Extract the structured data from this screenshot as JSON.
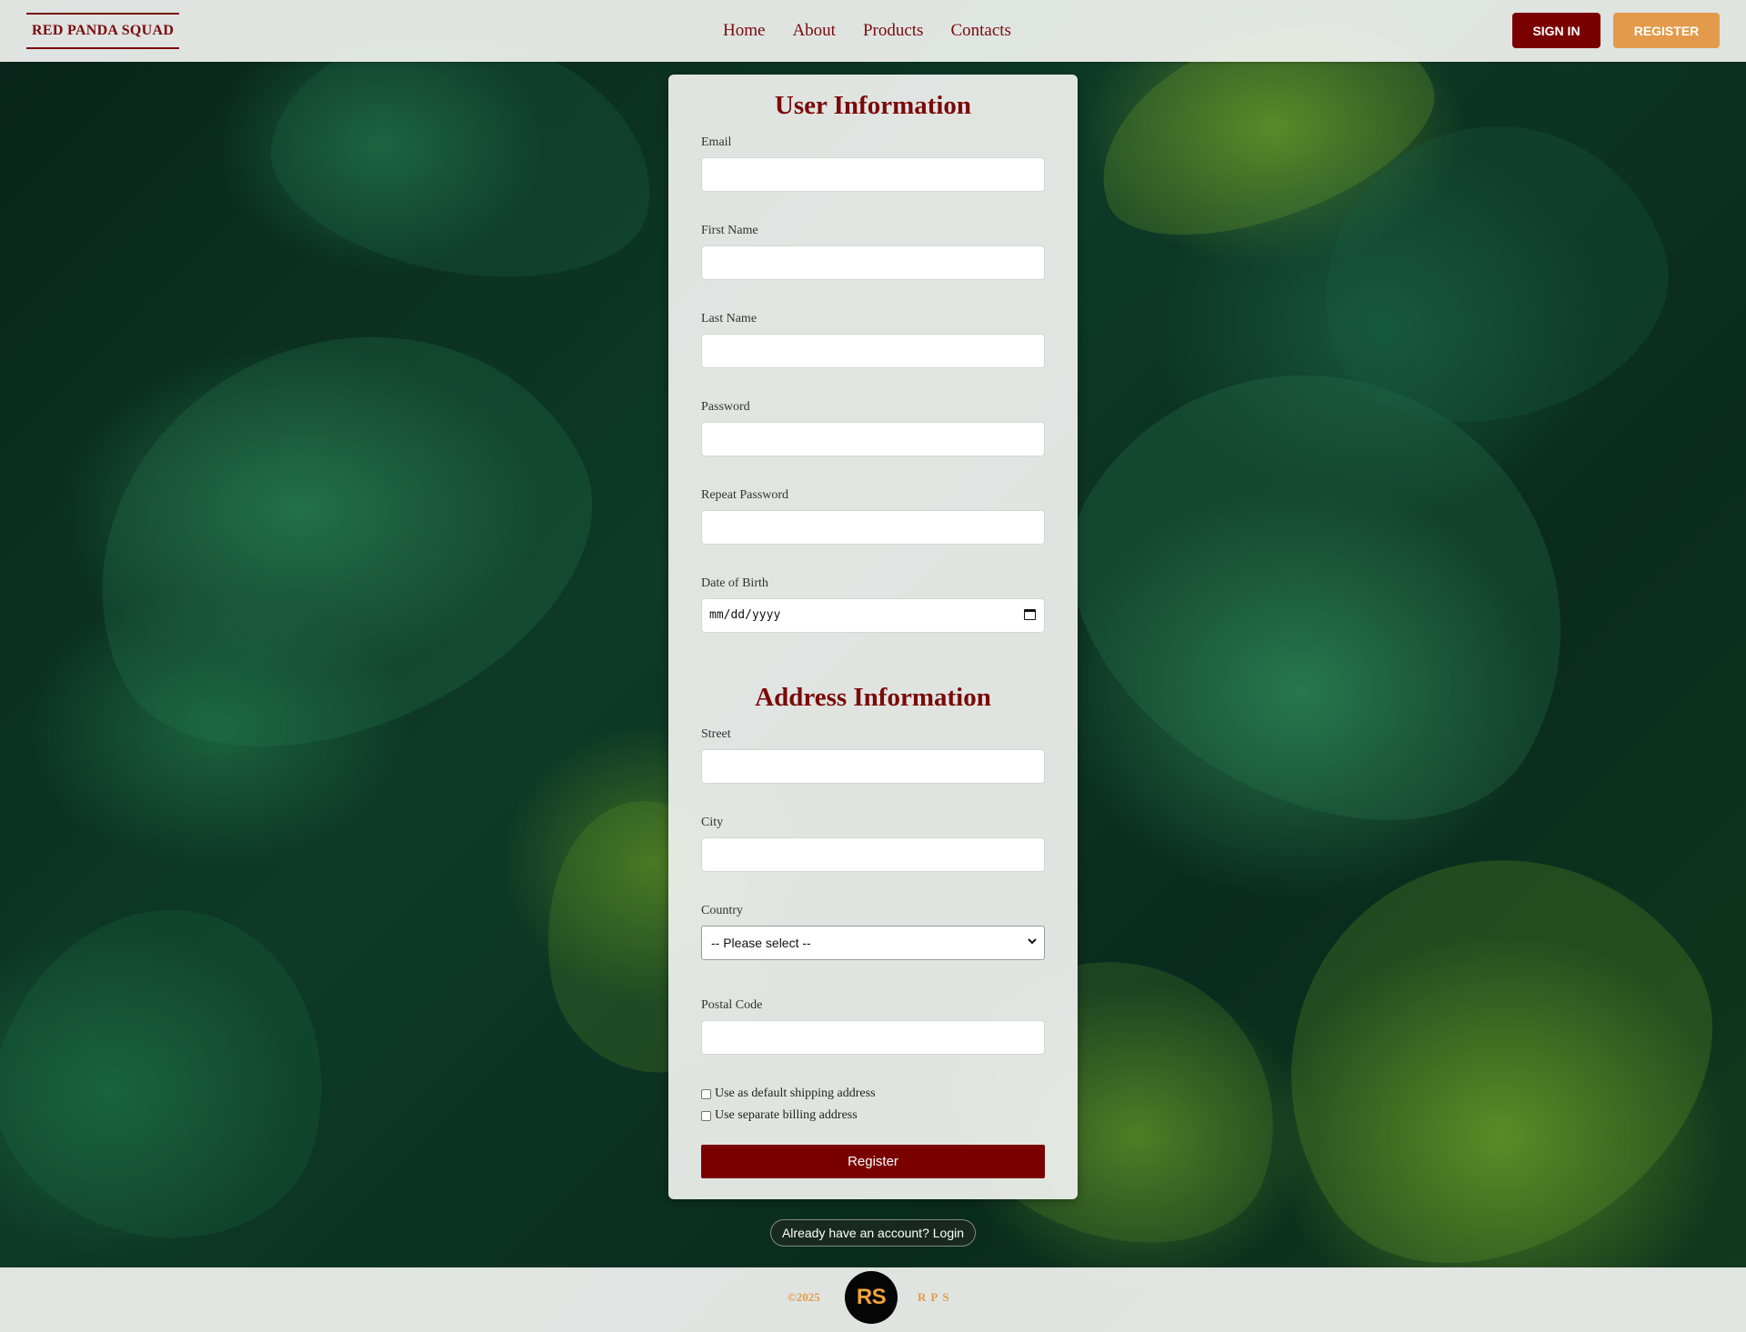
{
  "header": {
    "logo_text": "RED PANDA SQUAD",
    "nav": [
      "Home",
      "About",
      "Products",
      "Contacts"
    ],
    "sign_in_label": "SIGN IN",
    "register_label": "REGISTER"
  },
  "form": {
    "user_section_title": "User Information",
    "email_label": "Email",
    "email_value": "",
    "first_name_label": "First Name",
    "first_name_value": "",
    "last_name_label": "Last Name",
    "last_name_value": "",
    "password_label": "Password",
    "password_value": "",
    "repeat_password_label": "Repeat Password",
    "repeat_password_value": "",
    "dob_label": "Date of Birth",
    "dob_placeholder": "mm/dd/yyyy",
    "address_section_title": "Address Information",
    "street_label": "Street",
    "street_value": "",
    "city_label": "City",
    "city_value": "",
    "country_label": "Country",
    "country_selected": "-- Please select --",
    "postal_code_label": "Postal Code",
    "postal_code_value": "",
    "checkbox_default_shipping": "Use as default shipping address",
    "checkbox_default_shipping_checked": false,
    "checkbox_separate_billing": "Use separate billing address",
    "checkbox_separate_billing_checked": false,
    "submit_label": "Register"
  },
  "login_link_text": "Already have an account? Login",
  "footer": {
    "copyright": "©2025",
    "logo_text": "RS",
    "tagline": "RPS"
  },
  "colors": {
    "brand_dark_red": "#7a0000",
    "accent_orange": "#e39b4b"
  },
  "icons": {
    "date_picker": "calendar-icon",
    "select_arrow": "chevron-down-icon"
  }
}
